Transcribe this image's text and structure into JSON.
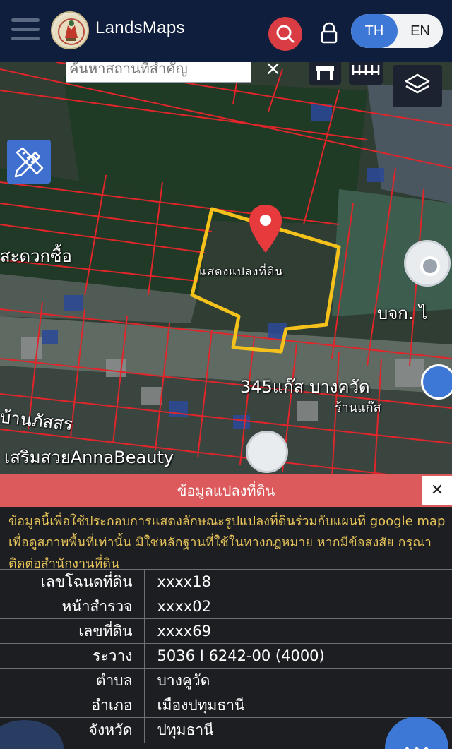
{
  "app": {
    "brand": "LandsMaps",
    "lang_th": "TH",
    "lang_en": "EN"
  },
  "map": {
    "search_placeholder": "ค้นหาสถานที่สำคัญ",
    "clear_label": "×",
    "labels": {
      "road_left": "สะดวกซื้อ",
      "parcel_tag": "แสดงแปลงที่ดิน",
      "gas_station": "345แก๊ส บางควัด",
      "gas_sub": "ร้านแก๊ส",
      "village": "บ้านภัสสร",
      "salon": "เสริมสวยAnnaBeauty",
      "bkg": "บจก. ไ"
    }
  },
  "panel": {
    "title": "ข้อมูลแปลงที่ดิน",
    "close": "✕",
    "disclaimer": "ข้อมูลนี้เพื่อใช้ประกอบการแสดงลักษณะรูปแปลงที่ดินร่วมกับแผนที่ google map เพื่อดูสภาพพื้นที่เท่านั้น มิใช่หลักฐานที่ใช้ในทางกฎหมาย หากมีข้อสงสัย กรุณาติดต่อสำนักงานที่ดิน",
    "rows": [
      {
        "label": "เลขโฉนดที่ดิน",
        "value": "xxxx18"
      },
      {
        "label": "หน้าสำรวจ",
        "value": "xxxx02"
      },
      {
        "label": "เลขที่ดิน",
        "value": "xxxx69"
      },
      {
        "label": "ระวาง",
        "value": "5036 I 6242-00 (4000)"
      },
      {
        "label": "ตำบล",
        "value": "บางคูวัด"
      },
      {
        "label": "อำเภอ",
        "value": "เมืองปทุมธานี"
      },
      {
        "label": "จังหวัด",
        "value": "ปทุมธานี"
      }
    ]
  },
  "colors": {
    "header_bg": "#0f1e3d",
    "accent_blue": "#3e78d6",
    "search_red": "#d93d43",
    "panel_title_bg": "#dd5a5c",
    "disclaimer_text": "#e7c45a",
    "parcel_outline": "#f5c21b",
    "boundary_red": "#e0262b"
  },
  "icons": {
    "menu": "hamburger-icon",
    "search": "search-icon",
    "lock": "lock-icon",
    "draw": "pencil-ruler-icon",
    "layers": "layers-icon",
    "locate": "locate-icon",
    "pin": "map-pin-icon",
    "chat": "chat-icon"
  }
}
